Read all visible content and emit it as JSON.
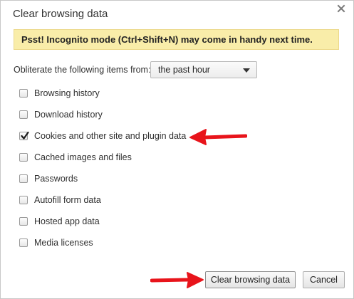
{
  "dialog": {
    "title": "Clear browsing data",
    "close_icon": "close-icon"
  },
  "banner": {
    "text": "Psst! Incognito mode (Ctrl+Shift+N) may come in handy next time."
  },
  "time_range": {
    "label": "Obliterate the following items from:",
    "selected": "the past hour"
  },
  "options": [
    {
      "label": "Browsing history",
      "checked": false
    },
    {
      "label": "Download history",
      "checked": false
    },
    {
      "label": "Cookies and other site and plugin data",
      "checked": true
    },
    {
      "label": "Cached images and files",
      "checked": false
    },
    {
      "label": "Passwords",
      "checked": false
    },
    {
      "label": "Autofill form data",
      "checked": false
    },
    {
      "label": "Hosted app data",
      "checked": false
    },
    {
      "label": "Media licenses",
      "checked": false
    }
  ],
  "buttons": {
    "clear": "Clear browsing data",
    "cancel": "Cancel"
  },
  "colors": {
    "banner_bg": "#f9eda9",
    "annotation_arrow": "#e8141b"
  }
}
